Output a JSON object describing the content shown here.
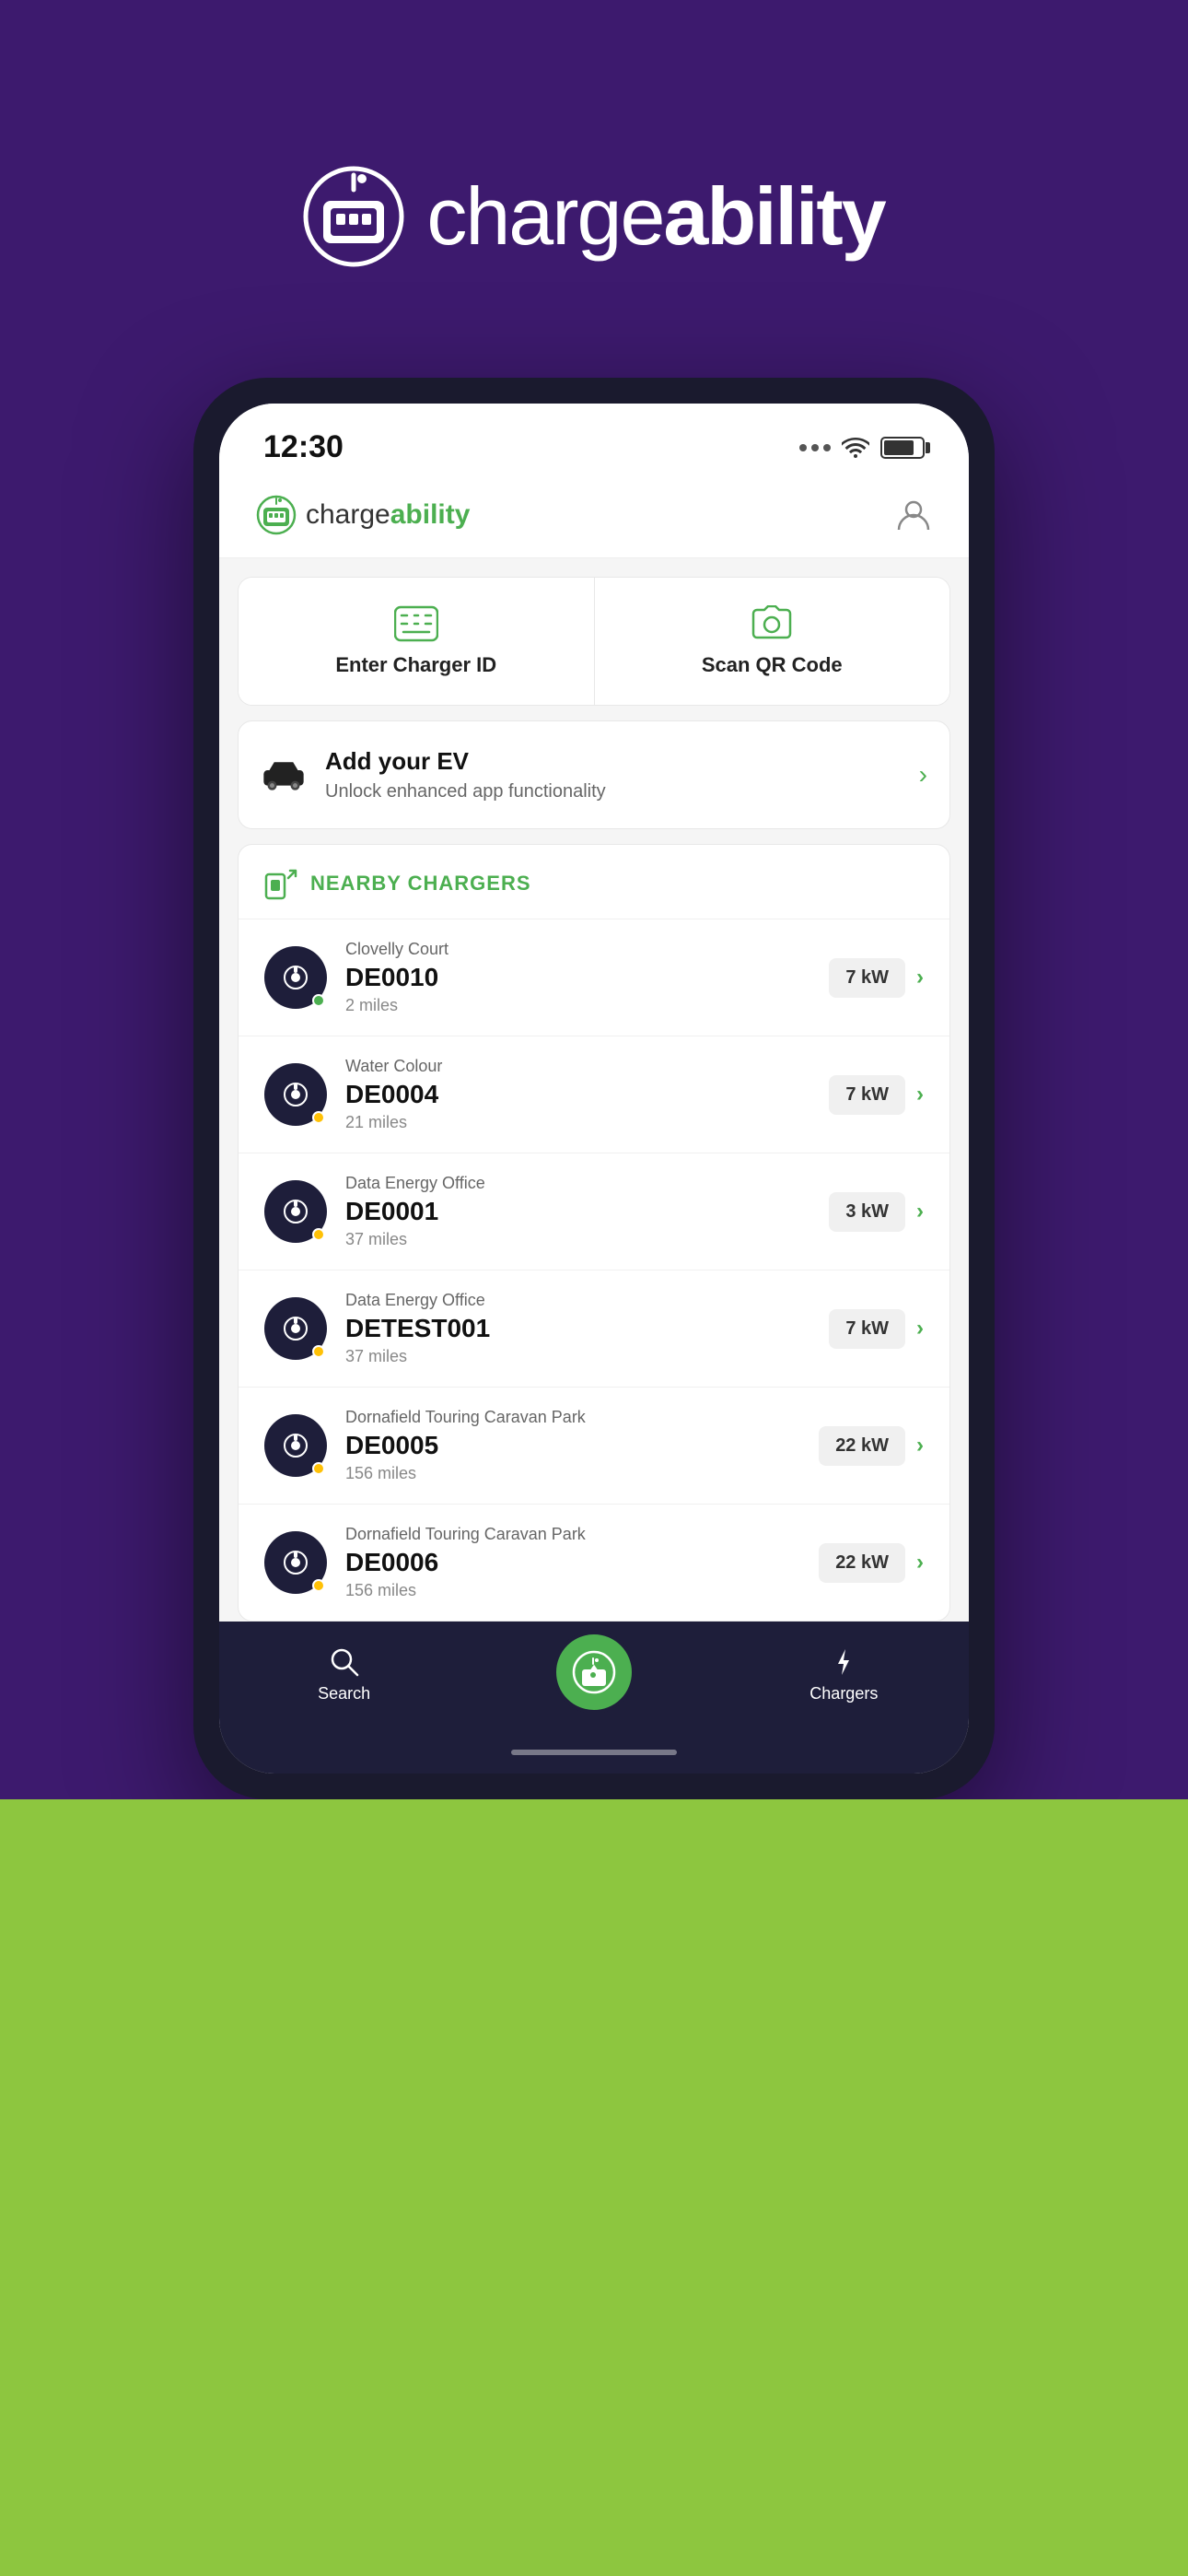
{
  "app": {
    "name_light": "charge",
    "name_bold": "ability"
  },
  "header": {
    "logo_alt": "chargeability logo"
  },
  "status_bar": {
    "time": "12:30"
  },
  "actions": {
    "enter_charger_id": "Enter Charger ID",
    "scan_qr_code": "Scan QR Code"
  },
  "add_ev": {
    "title": "Add your EV",
    "subtitle": "Unlock enhanced app functionality"
  },
  "nearby": {
    "section_title": "NEARBY CHARGERS"
  },
  "chargers": [
    {
      "location": "Clovelly Court",
      "id": "DE0010",
      "distance": "2 miles",
      "power": "7 kW",
      "status": "green"
    },
    {
      "location": "Water Colour",
      "id": "DE0004",
      "distance": "21 miles",
      "power": "7 kW",
      "status": "yellow"
    },
    {
      "location": "Data Energy Office",
      "id": "DE0001",
      "distance": "37 miles",
      "power": "3 kW",
      "status": "yellow"
    },
    {
      "location": "Data Energy Office",
      "id": "DETEST001",
      "distance": "37 miles",
      "power": "7 kW",
      "status": "yellow"
    },
    {
      "location": "Dornafield Touring Caravan Park",
      "id": "DE0005",
      "distance": "156 miles",
      "power": "22 kW",
      "status": "yellow"
    },
    {
      "location": "Dornafield Touring Caravan Park",
      "id": "DE0006",
      "distance": "156 miles",
      "power": "22 kW",
      "status": "yellow"
    }
  ],
  "nav": {
    "search_label": "Search",
    "chargers_label": "Chargers"
  },
  "colors": {
    "purple_bg": "#3d1a6e",
    "green_accent": "#4CAF50",
    "dark_navy": "#1e1e3a",
    "green_strip": "#8dc63f"
  }
}
